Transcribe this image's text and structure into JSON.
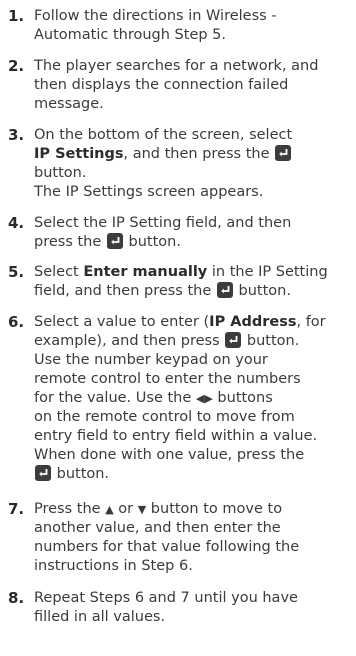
{
  "steps": [
    {
      "number": "1.",
      "lines": [
        "Follow the directions in Wireless -",
        "Automatic through Step 5."
      ]
    },
    {
      "number": "2.",
      "lines": [
        "The player searches for a network, and",
        "then displays the connection failed",
        "message."
      ]
    },
    {
      "number": "3.",
      "l1": "On the bottom of the screen, select",
      "l2_bold": "IP Settings",
      "l2_after": ", and then press the",
      "l3": "button.",
      "l4": "The IP Settings screen appears."
    },
    {
      "number": "4.",
      "l1": "Select the IP Setting field, and then",
      "l2_before": "press the",
      "l2_after": "button."
    },
    {
      "number": "5.",
      "l1_before": "Select",
      "l1_bold": "Enter manually",
      "l1_after": "in the IP Setting",
      "l2_before": "field, and then press the",
      "l2_after": "button."
    },
    {
      "number": "6.",
      "l1_before": "Select a value to enter (",
      "l1_bold": "IP Address",
      "l1_after": ", for",
      "l2_before": "example), and then press",
      "l2_after": "button.",
      "l3": "Use the number keypad on your",
      "l4": "remote control to enter the numbers",
      "l5_before": "for the value. Use the",
      "l5_glyph": "◀▶",
      "l5_after": "buttons",
      "l6": "on the remote control to move from",
      "l7": "entry field to entry field within a value.",
      "l8": "When done with one value, press the",
      "l9_after": "button."
    },
    {
      "number": "7.",
      "l1_before": "Press the",
      "l1_glyph_up": "▲",
      "l1_mid": "or",
      "l1_glyph_down": "▼",
      "l1_after": "button to move to",
      "l2": "another value, and then enter the",
      "l3": "numbers for that value following the",
      "l4": "instructions in Step 6."
    },
    {
      "number": "8.",
      "lines": [
        "Repeat Steps 6 and 7 until you have",
        "filled in all values."
      ]
    }
  ],
  "icons": {
    "enter": "enter-icon",
    "left_right": "left-right-arrows-icon",
    "up": "up-arrow-icon",
    "down": "down-arrow-icon"
  }
}
